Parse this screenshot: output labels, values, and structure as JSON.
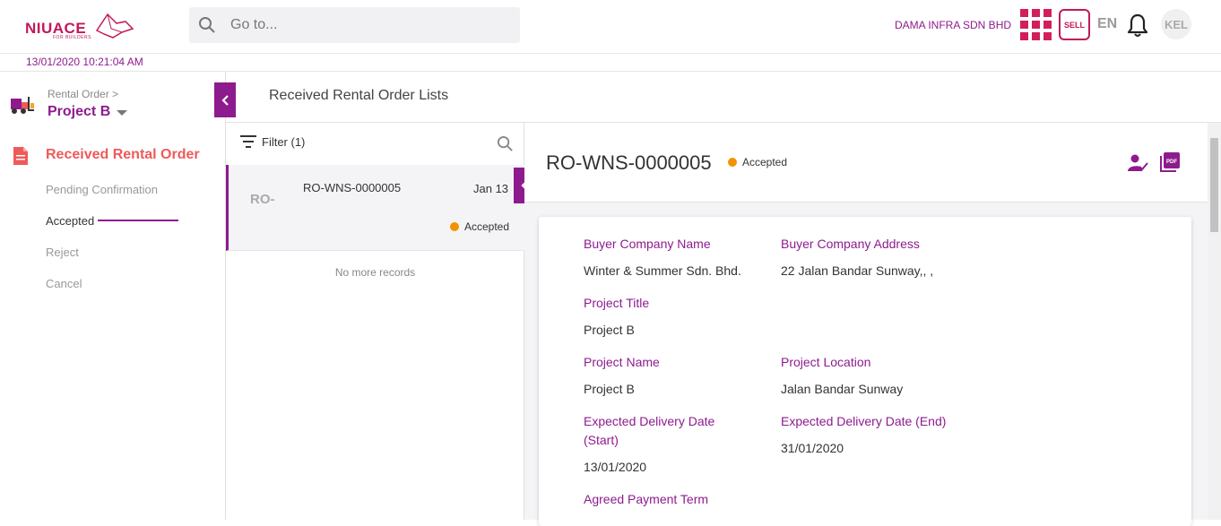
{
  "header": {
    "logo_text": "NIUACE",
    "logo_sub": "FOR BUILDERS",
    "search_placeholder": "Go to...",
    "company": "DAMA INFRA SDN BHD",
    "sell_label": "SELL",
    "language": "EN",
    "avatar": "KEL",
    "icons": [
      "search-icon",
      "apps-grid-icon",
      "bell-icon"
    ]
  },
  "datetime": "13/01/2020 10:21:04 AM",
  "sidebar": {
    "breadcrumb": "Rental Order >",
    "project": "Project B",
    "menu_title": "Received Rental Order",
    "items": [
      {
        "label": "Pending Confirmation"
      },
      {
        "label": "Accepted"
      },
      {
        "label": "Reject"
      },
      {
        "label": "Cancel"
      }
    ]
  },
  "main": {
    "title": "Received Rental Order Lists"
  },
  "list": {
    "filter_label": "Filter (1)",
    "items": [
      {
        "thumb": "RO-",
        "code": "RO-WNS-0000005",
        "date": "Jan 13",
        "status": "Accepted"
      }
    ],
    "footer": "No more records"
  },
  "detail": {
    "code": "RO-WNS-0000005",
    "status": "Accepted",
    "status_color": "#f39200",
    "fields": {
      "buyer_company_name": {
        "label": "Buyer Company Name",
        "value": "Winter & Summer Sdn. Bhd."
      },
      "buyer_company_address": {
        "label": "Buyer Company Address",
        "value": "22 Jalan Bandar Sunway,, ,"
      },
      "project_title": {
        "label": "Project Title",
        "value": "Project B"
      },
      "project_name": {
        "label": "Project Name",
        "value": "Project B"
      },
      "project_location": {
        "label": "Project Location",
        "value": "Jalan Bandar Sunway"
      },
      "delivery_start": {
        "label_line1": "Expected Delivery Date",
        "label_line2": "(Start)",
        "value": "13/01/2020"
      },
      "delivery_end": {
        "label": "Expected Delivery Date (End)",
        "value": "31/01/2020"
      },
      "payment_term": {
        "label": "Agreed Payment Term"
      }
    }
  },
  "colors": {
    "brand": "#8e1b8e",
    "accent_red": "#ef5a5a",
    "logo": "#c2185b",
    "grid": "#d21f5a"
  }
}
